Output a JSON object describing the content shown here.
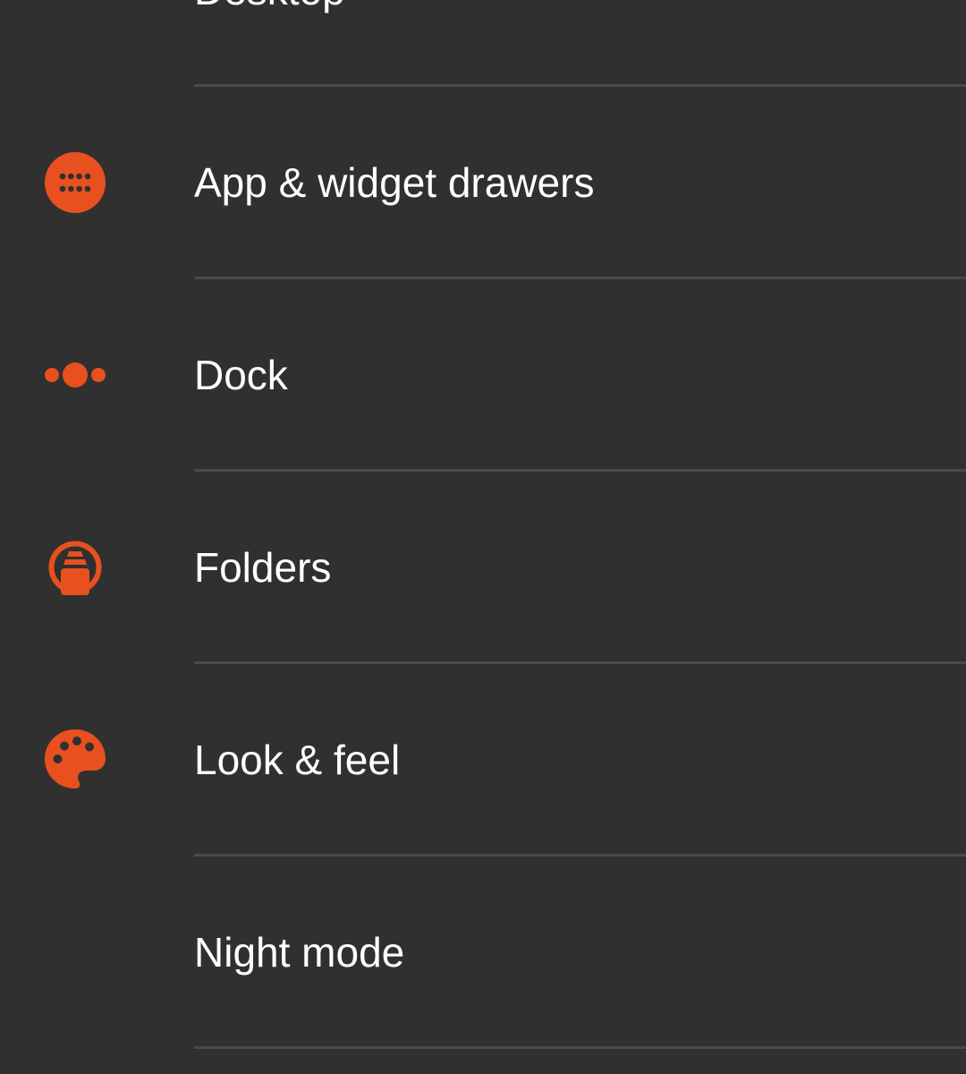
{
  "theme": {
    "background": "#303030",
    "accent": "#e8501f",
    "divider": "#4a4a4a",
    "text": "#ffffff"
  },
  "settings": {
    "items": [
      {
        "label": "Desktop",
        "icon": "desktop-icon"
      },
      {
        "label": "App & widget drawers",
        "icon": "app-drawer-icon"
      },
      {
        "label": "Dock",
        "icon": "dock-icon"
      },
      {
        "label": "Folders",
        "icon": "folders-icon"
      },
      {
        "label": "Look & feel",
        "icon": "palette-icon"
      },
      {
        "label": "Night mode",
        "icon": "moon-icon"
      }
    ]
  }
}
